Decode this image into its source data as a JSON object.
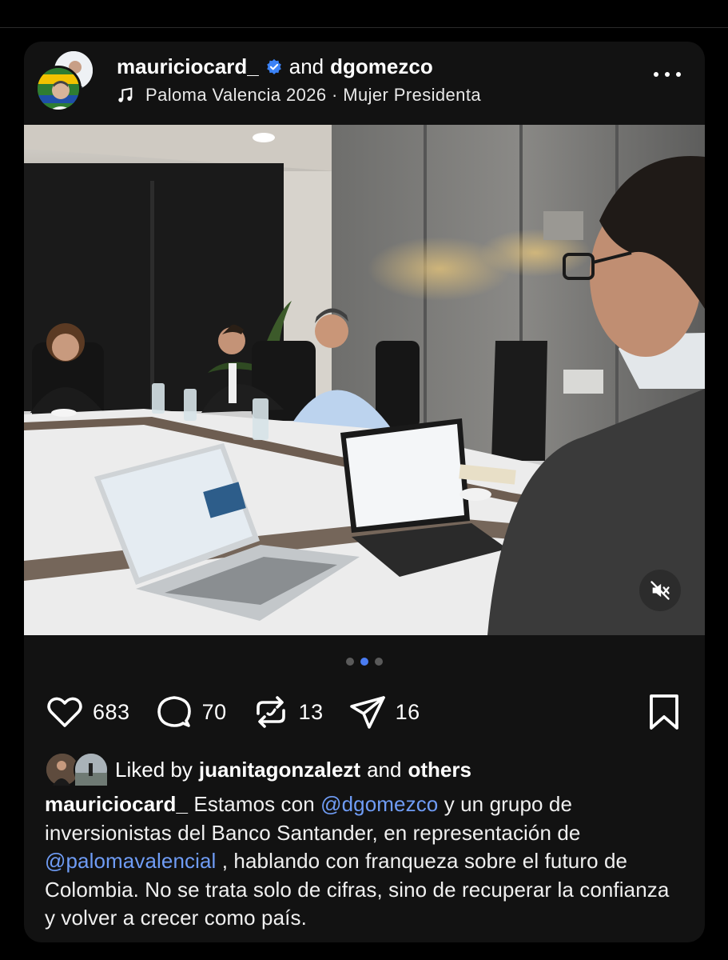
{
  "post": {
    "author_primary": "mauriciocard_",
    "author_connector": "and",
    "author_secondary": "dgomezco",
    "music": "Paloma Valencia 2026 · Mujer Presidenta"
  },
  "carousel": {
    "total": 3,
    "active_index": 1
  },
  "actions": {
    "likes": "683",
    "comments": "70",
    "reposts": "13",
    "shares": "16"
  },
  "liked_by": {
    "prefix": "Liked by",
    "user": "juanitagonzalezt",
    "connector": "and",
    "others": "others"
  },
  "caption": {
    "user": "mauriciocard_",
    "part1": "Estamos con",
    "mention1": "@dgomezco",
    "part2": "y un grupo de inversionistas del Banco Santander, en representación de",
    "mention2": "@palomavalencial",
    "part3": ", hablando con franqueza sobre el futuro de Colombia. No se trata solo de cifras, sino de recuperar la confianza y volver a crecer como país."
  },
  "colors": {
    "background": "#000000",
    "card": "#121212",
    "mention": "#6f9cf5",
    "verified": "#3b82f6",
    "active_dot": "#4a7cf2"
  },
  "icons": [
    "verified-icon",
    "music-note-icon",
    "more-icon",
    "mute-icon",
    "heart-icon",
    "comment-icon",
    "repost-icon",
    "share-icon",
    "bookmark-icon"
  ]
}
